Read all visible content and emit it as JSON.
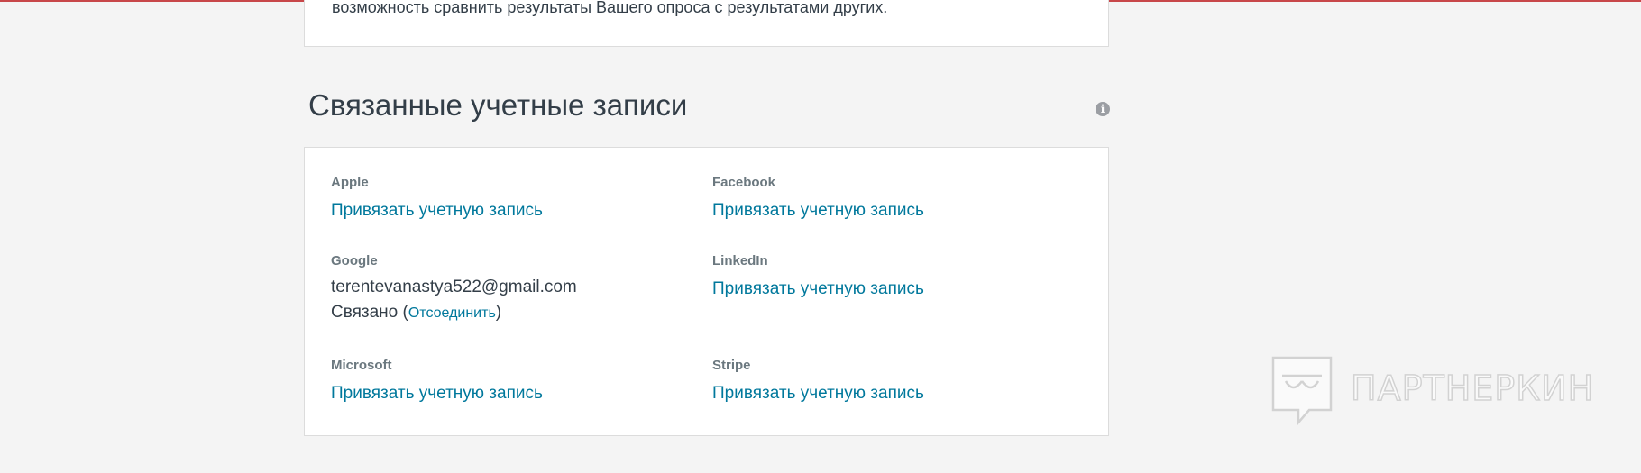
{
  "previous_section": {
    "text": "возможность сравнить результаты Вашего опроса с результатами других."
  },
  "linked_accounts": {
    "title": "Связанные учетные записи",
    "info_icon": "i",
    "accounts": [
      {
        "provider": "Apple",
        "action": "Привязать учетную запись"
      },
      {
        "provider": "Facebook",
        "action": "Привязать учетную запись"
      },
      {
        "provider": "Google",
        "email": "terentevanastya522@gmail.com",
        "status": "Связано",
        "unlink": "Отсоединить"
      },
      {
        "provider": "LinkedIn",
        "action": "Привязать учетную запись"
      },
      {
        "provider": "Microsoft",
        "action": "Привязать учетную запись"
      },
      {
        "provider": "Stripe",
        "action": "Привязать учетную запись"
      }
    ]
  },
  "watermark": {
    "text": "ПАРТНЕРКИН"
  },
  "colors": {
    "link": "#00789c",
    "text": "#333e48",
    "label": "#6b787f",
    "background": "#f4f4f4",
    "top_line": "#c8474a"
  }
}
